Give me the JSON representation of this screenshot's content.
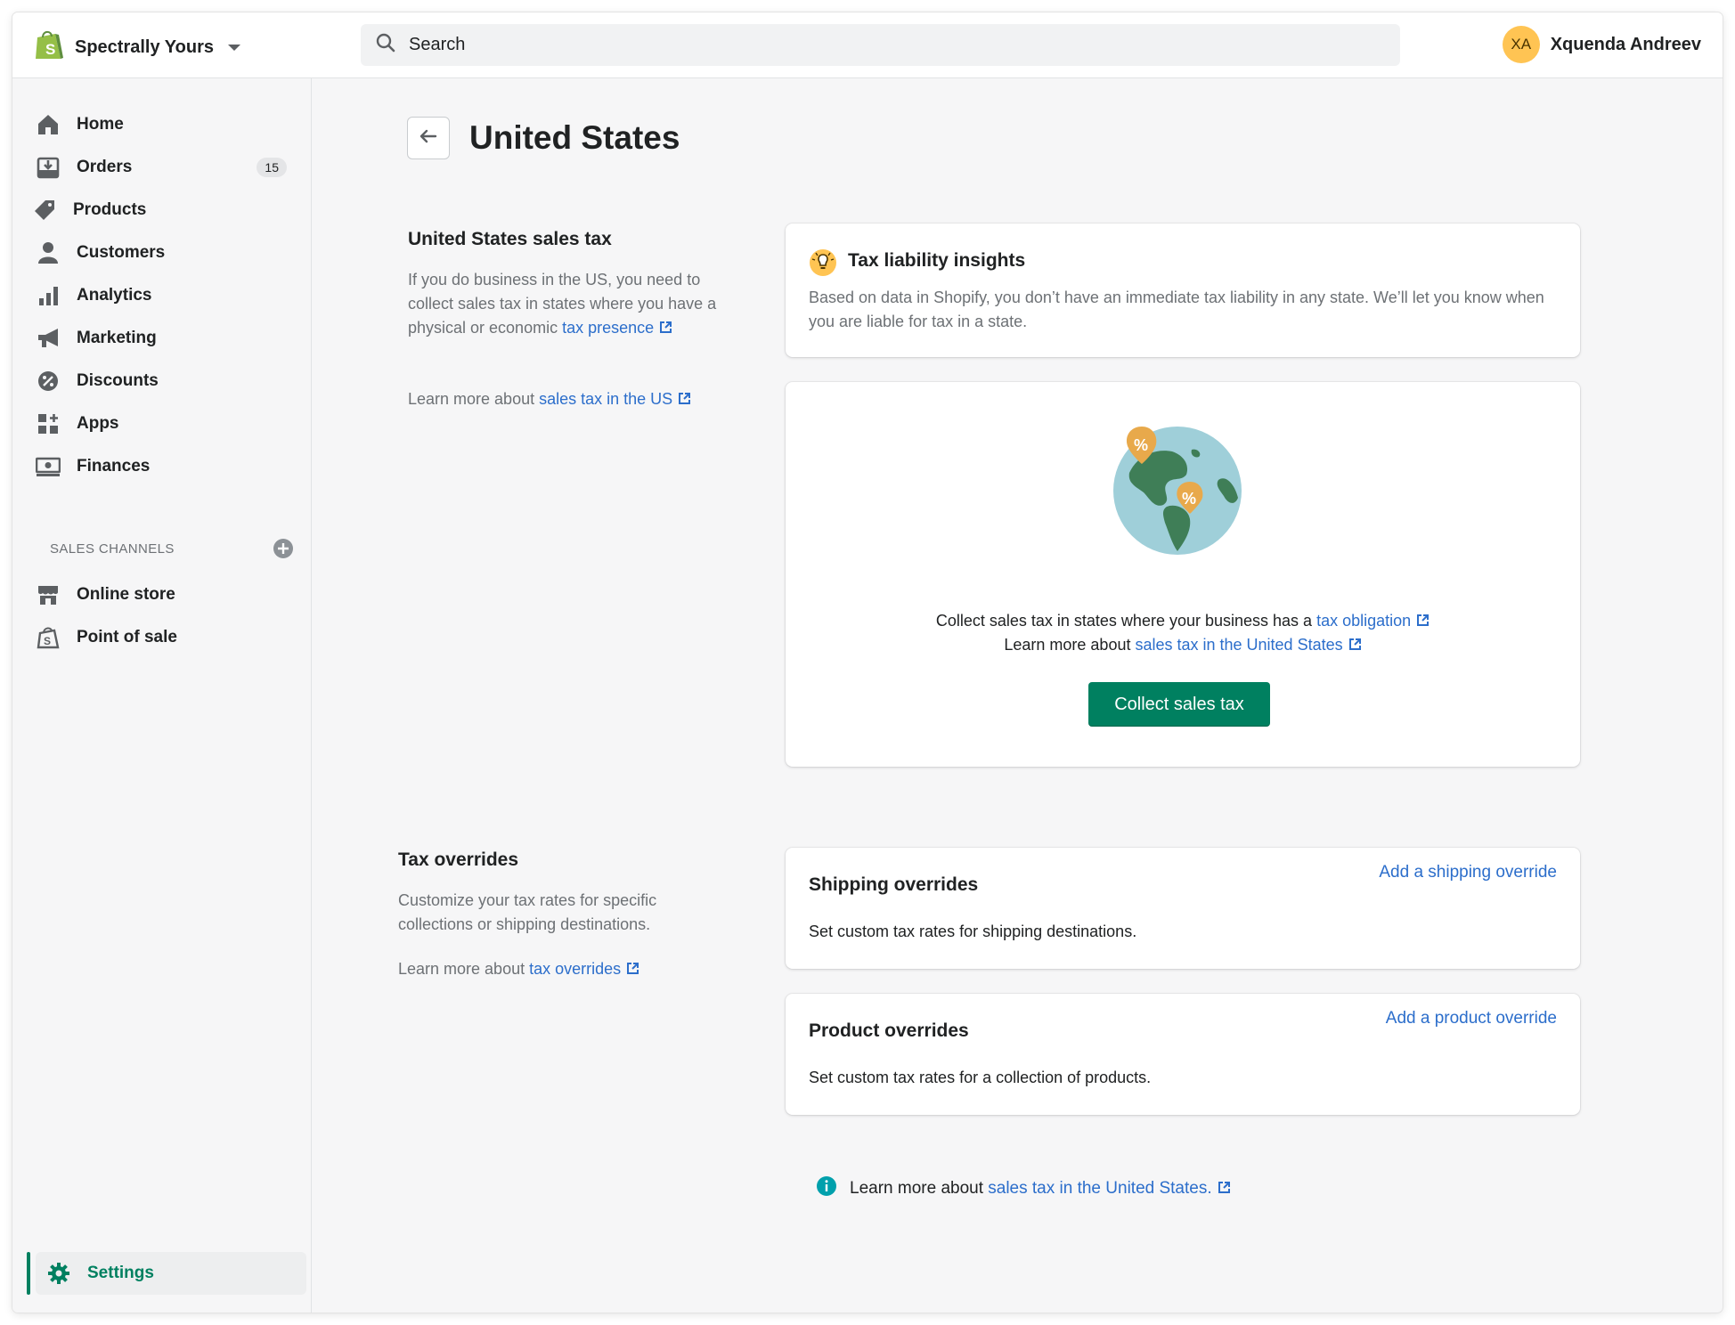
{
  "topbar": {
    "store_name": "Spectrally Yours",
    "search_placeholder": "Search",
    "user_initials": "XA",
    "user_name": "Xquenda Andreev"
  },
  "sidebar": {
    "items": [
      {
        "label": "Home",
        "icon": "home-icon"
      },
      {
        "label": "Orders",
        "icon": "orders-icon",
        "badge": "15"
      },
      {
        "label": "Products",
        "icon": "tag-icon"
      },
      {
        "label": "Customers",
        "icon": "person-icon"
      },
      {
        "label": "Analytics",
        "icon": "bar-chart-icon"
      },
      {
        "label": "Marketing",
        "icon": "megaphone-icon"
      },
      {
        "label": "Discounts",
        "icon": "discount-icon"
      },
      {
        "label": "Apps",
        "icon": "apps-icon"
      },
      {
        "label": "Finances",
        "icon": "finances-icon"
      }
    ],
    "channels_heading": "SALES CHANNELS",
    "channels": [
      {
        "label": "Online store",
        "icon": "store-icon"
      },
      {
        "label": "Point of sale",
        "icon": "pos-icon"
      }
    ],
    "settings_label": "Settings"
  },
  "page": {
    "title": "United States",
    "sales_tax": {
      "heading": "United States sales tax",
      "desc": "If you do business in the US, you need to collect sales tax in states where you have a physical or economic ",
      "desc_link": "tax presence",
      "learn_prefix": "Learn more about ",
      "learn_link": "sales tax in the US"
    },
    "insight": {
      "title": "Tax liability insights",
      "text": "Based on data in Shopify, you don’t have an immediate tax liability in any state. We’ll let you know when you are liable for tax in a state."
    },
    "collect": {
      "line1_prefix": "Collect sales tax in states where your business has a ",
      "line1_link": "tax obligation",
      "line2_prefix": "Learn more about ",
      "line2_link": "sales tax in the United States",
      "button": "Collect sales tax"
    },
    "overrides": {
      "heading": "Tax overrides",
      "desc": "Customize your tax rates for specific collections or shipping destinations.",
      "learn_prefix": "Learn more about ",
      "learn_link": "tax overrides",
      "shipping": {
        "title": "Shipping overrides",
        "action": "Add a shipping override",
        "desc": "Set custom tax rates for shipping destinations."
      },
      "product": {
        "title": "Product overrides",
        "action": "Add a product override",
        "desc": "Set custom tax rates for a collection of products."
      }
    },
    "footer": {
      "prefix": "Learn more about ",
      "link": "sales tax in the United States."
    }
  },
  "colors": {
    "accent": "#008060",
    "link": "#2c6ecb",
    "avatar": "#ffc453"
  }
}
